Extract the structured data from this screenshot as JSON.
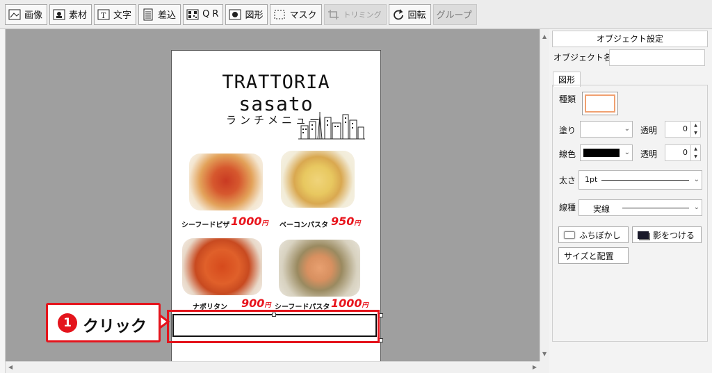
{
  "toolbar": {
    "image": "画像",
    "material": "素材",
    "text": "文字",
    "merge": "差込",
    "qr": "Q R",
    "shape": "図形",
    "mask": "マスク",
    "trim": "トリミング",
    "rotate": "回転",
    "group": "グループ"
  },
  "menu": {
    "title_line1": "TRATTORIA",
    "title_line2": "sasato",
    "subtitle": "ランチメニュー",
    "items": [
      {
        "name": "シーフードピザ",
        "price": "1000",
        "unit": "円"
      },
      {
        "name": "ベーコンパスタ",
        "price": "950",
        "unit": "円"
      },
      {
        "name": "ナポリタン",
        "price": "900",
        "unit": "円"
      },
      {
        "name": "シーフードパスタ",
        "price": "1000",
        "unit": "円"
      }
    ]
  },
  "callout": {
    "number": "1",
    "text": "クリック"
  },
  "panel": {
    "title": "オブジェクト設定",
    "object_name_label": "オブジェクト名",
    "object_name_value": "",
    "tab_shape": "図形",
    "kind_label": "種類",
    "fill_label": "塗り",
    "fill_transparency_label": "透明",
    "fill_transparency_value": "0",
    "line_color_label": "線色",
    "line_transparency_label": "透明",
    "line_transparency_value": "0",
    "thickness_label": "太さ",
    "thickness_value": "1pt",
    "line_type_label": "線種",
    "line_type_value": "実線",
    "blur_button": "ふちぼかし",
    "shadow_button": "影をつける",
    "size_button": "サイズと配置"
  },
  "colors": {
    "accent_red": "#e4141c",
    "price_red": "#e8141c",
    "kind_border": "#f0a070"
  }
}
